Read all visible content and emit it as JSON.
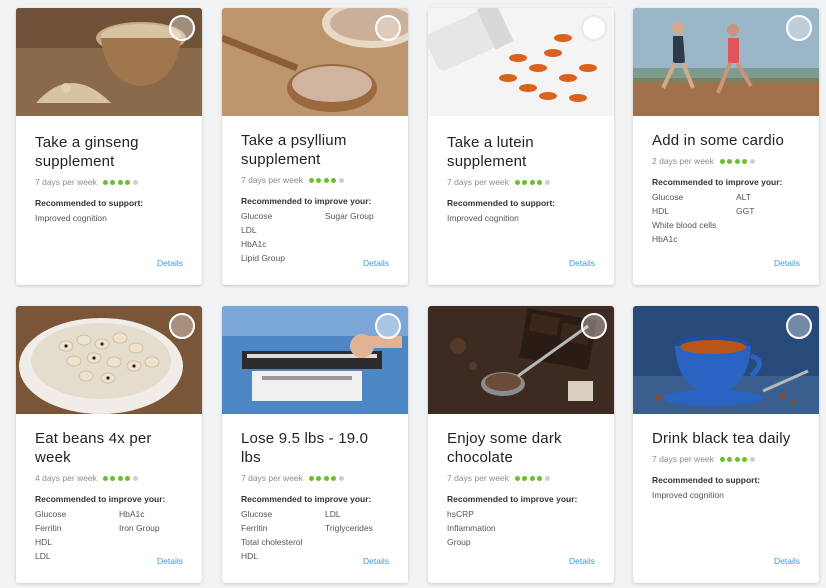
{
  "cards": [
    {
      "title": "Take a ginseng supplement",
      "frequency": "7 days per week",
      "dots_filled": 4,
      "rec_label": "Recommended to support:",
      "metrics": [
        "Improved cognition"
      ],
      "details_label": "Details",
      "image": "ginseng-powder-image"
    },
    {
      "title": "Take a psyllium supplement",
      "frequency": "7 days per week",
      "dots_filled": 4,
      "rec_label": "Recommended to improve your:",
      "metrics": [
        "Glucose",
        "Sugar Group",
        "LDL",
        "",
        "HbA1c",
        "",
        "Lipid Group",
        ""
      ],
      "details_label": "Details",
      "image": "psyllium-spoon-image"
    },
    {
      "title": "Take a lutein supplement",
      "frequency": "7 days per week",
      "dots_filled": 4,
      "rec_label": "Recommended to support:",
      "metrics": [
        "Improved cognition"
      ],
      "details_label": "Details",
      "image": "softgel-capsules-image"
    },
    {
      "title": "Add in some cardio",
      "frequency": "2 days per week",
      "dots_filled": 4,
      "rec_label": "Recommended to improve your:",
      "metrics": [
        "Glucose",
        "ALT",
        "HDL",
        "GGT",
        "White blood cells",
        "",
        "HbA1c",
        ""
      ],
      "details_label": "Details",
      "image": "runners-image"
    },
    {
      "title": "Eat beans 4x per week",
      "frequency": "4 days per week",
      "dots_filled": 4,
      "rec_label": "Recommended to improve your:",
      "metrics": [
        "Glucose",
        "HbA1c",
        "Ferritin",
        "Iron Group",
        "HDL",
        "",
        "LDL",
        ""
      ],
      "details_label": "Details",
      "image": "black-eyed-beans-image"
    },
    {
      "title": "Lose 9.5 lbs - 19.0 lbs",
      "frequency": "7 days per week",
      "dots_filled": 4,
      "rec_label": "Recommended to improve your:",
      "metrics": [
        "Glucose",
        "LDL",
        "Ferritin",
        "Triglycerides",
        "Total cholesterol",
        "",
        "HDL",
        ""
      ],
      "details_label": "Details",
      "image": "weight-scale-image"
    },
    {
      "title": "Enjoy some dark chocolate",
      "frequency": "7 days per week",
      "dots_filled": 4,
      "rec_label": "Recommended to improve your:",
      "metrics": [
        "hsCRP",
        "",
        "Inflammation",
        "",
        "Group",
        ""
      ],
      "details_label": "Details",
      "image": "dark-chocolate-image"
    },
    {
      "title": "Drink black tea daily",
      "frequency": "7 days per week",
      "dots_filled": 4,
      "rec_label": "Recommended to support:",
      "metrics": [
        "Improved cognition"
      ],
      "details_label": "Details",
      "image": "black-tea-cup-image"
    }
  ],
  "colors": {
    "accent_green": "#6cbf2a",
    "link_blue": "#3a9bd8",
    "dot_off": "#cfcfcf"
  }
}
